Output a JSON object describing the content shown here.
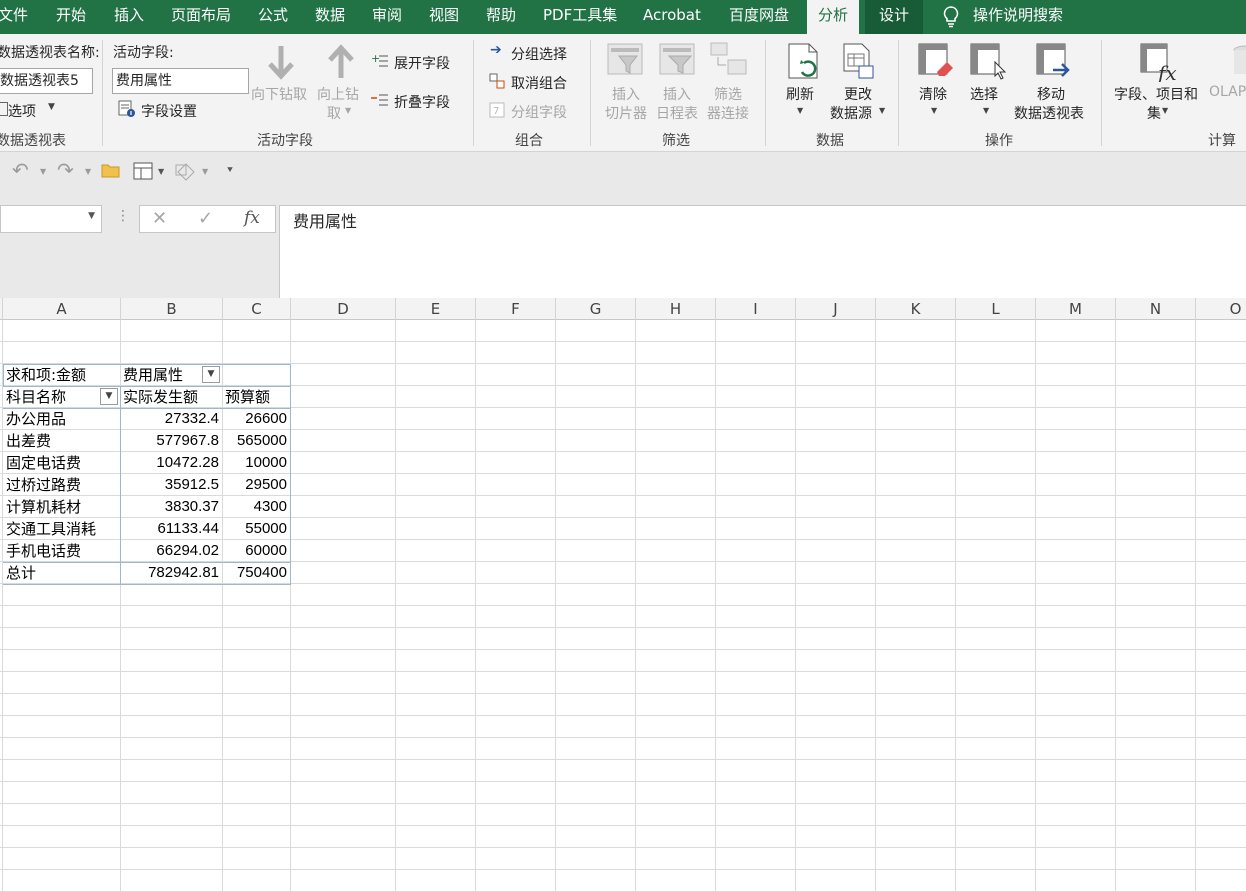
{
  "menu": {
    "tabs": [
      "文件",
      "开始",
      "插入",
      "页面布局",
      "公式",
      "数据",
      "审阅",
      "视图",
      "帮助",
      "PDF工具集",
      "Acrobat",
      "百度网盘",
      "分析",
      "设计"
    ],
    "active_tab": "分析",
    "tell_me": "操作说明搜索"
  },
  "ribbon": {
    "pivot": {
      "name_label": "数据透视表名称:",
      "name_value": "数据透视表5",
      "options": "选项",
      "group": "数据透视表"
    },
    "active_field": {
      "label": "活动字段:",
      "value": "费用属性",
      "settings": "字段设置",
      "drill_down": "向下钻取",
      "drill_up_1": "向上钻",
      "drill_up_2": "取",
      "expand": "展开字段",
      "collapse": "折叠字段",
      "group": "活动字段"
    },
    "grouping": {
      "group_selection": "分组选择",
      "ungroup": "取消组合",
      "group_field": "分组字段",
      "group": "组合"
    },
    "filter": {
      "slicer_1": "插入",
      "slicer_2": "切片器",
      "timeline_1": "插入",
      "timeline_2": "日程表",
      "conn_1": "筛选",
      "conn_2": "器连接",
      "group": "筛选"
    },
    "data": {
      "refresh": "刷新",
      "change_1": "更改",
      "change_2": "数据源",
      "group": "数据"
    },
    "actions": {
      "clear": "清除",
      "select": "选择",
      "move_1": "移动",
      "move_2": "数据透视表",
      "group": "操作"
    },
    "calc": {
      "fields_1": "字段、项目和",
      "fields_2": "集",
      "olap": "OLAP",
      "group": "计算"
    }
  },
  "formula_bar": {
    "cancel": "✕",
    "enter": "✓",
    "fx": "fx",
    "content": "费用属性"
  },
  "sheet": {
    "columns": [
      "A",
      "B",
      "C",
      "D",
      "E",
      "F",
      "G",
      "H",
      "I",
      "J",
      "K",
      "L",
      "M",
      "N",
      "O"
    ],
    "pivot": {
      "corner": "求和项:金额",
      "col_field": "费用属性",
      "row_field": "科目名称",
      "col_heads": [
        "实际发生额",
        "预算额"
      ],
      "rows": [
        {
          "name": "办公用品",
          "actual": "27332.4",
          "budget": "26600"
        },
        {
          "name": "出差费",
          "actual": "577967.8",
          "budget": "565000"
        },
        {
          "name": "固定电话费",
          "actual": "10472.28",
          "budget": "10000"
        },
        {
          "name": "过桥过路费",
          "actual": "35912.5",
          "budget": "29500"
        },
        {
          "name": "计算机耗材",
          "actual": "3830.37",
          "budget": "4300"
        },
        {
          "name": "交通工具消耗",
          "actual": "61133.44",
          "budget": "55000"
        },
        {
          "name": "手机电话费",
          "actual": "66294.02",
          "budget": "60000"
        }
      ],
      "total": {
        "name": "总计",
        "actual": "782942.81",
        "budget": "750400"
      }
    }
  }
}
